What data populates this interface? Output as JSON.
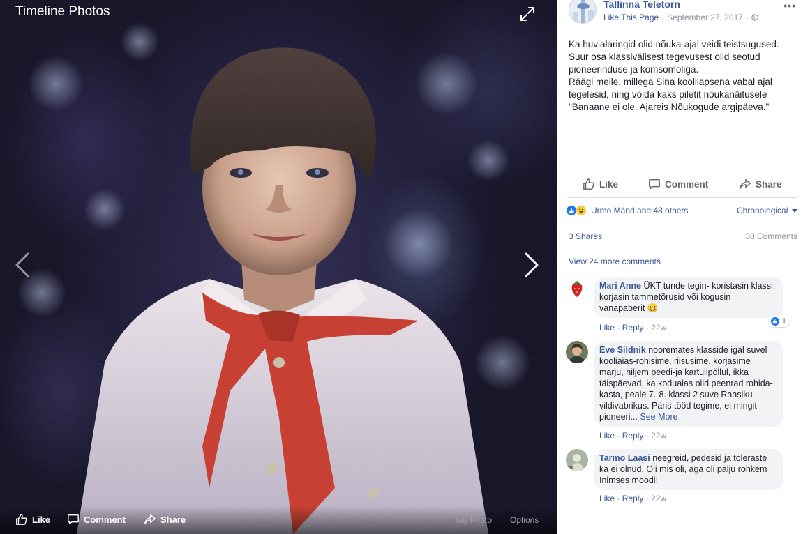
{
  "viewer": {
    "title": "Timeline Photos",
    "actions": {
      "like": "Like",
      "comment": "Comment",
      "share": "Share"
    },
    "links": {
      "tag_photo": "Tag Photo",
      "options": "Options"
    }
  },
  "post": {
    "page_name": "Tallinna Teletorn",
    "like_page": "Like This Page",
    "date": "September 27, 2017",
    "text_lines": [
      "Ka huvialaringid olid nõuka-ajal veidi teistsugused.",
      "Suur osa klassivälisest tegevusest olid seotud",
      "pioneerinduse ja komsomoliga.",
      "Räägi meile, millega Sina koolilapsena vabal ajal",
      "tegelesid, ning võida kaks piletit nõukanäitusele",
      "\"Banaane ei ole. Ajareis Nõukogude argipäeva.\""
    ],
    "actions": {
      "like": "Like",
      "comment": "Comment",
      "share": "Share"
    },
    "reactions_text": "Urmo Mänd and 48 others",
    "sort_label": "Chronological",
    "shares": "3 Shares",
    "comments_count": "30 Comments",
    "view_more": "View 24 more comments"
  },
  "comments": [
    {
      "name": "Mari Anne",
      "text": "ÜKT tunde tegin- koristasin klassi, korjasin tammetõrusid või kogusin vanapaberit 😆",
      "see_more": "",
      "like": "Like",
      "reply": "Reply",
      "time": "22w",
      "reaction_count": "1"
    },
    {
      "name": "Eve Sildnik",
      "text": "nooremates klasside igal suvel kooliaias-rohisime, riisusime, korjasime marju, hiljem peedi-ja kartulipõllul, ikka täispäevad, ka koduaias olid peenrad rohida-kasta, peale 7.-8. klassi 2 suve Raasiku vildivabrikus. Päris tööd tegime, ei mingit pioneeri...",
      "see_more": "See More",
      "like": "Like",
      "reply": "Reply",
      "time": "22w"
    },
    {
      "name": "Tarmo Laasi",
      "text": "neegreid, pedesid ja toleraste ka ei olnud. Oli mis oli, aga oli palju rohkem Inimses moodi!",
      "see_more": "",
      "like": "Like",
      "reply": "Reply",
      "time": "22w"
    }
  ],
  "colors": {
    "link": "#385898",
    "muted": "#90949c",
    "bubble": "#f2f3f5",
    "like_blue": "#1877f2"
  }
}
